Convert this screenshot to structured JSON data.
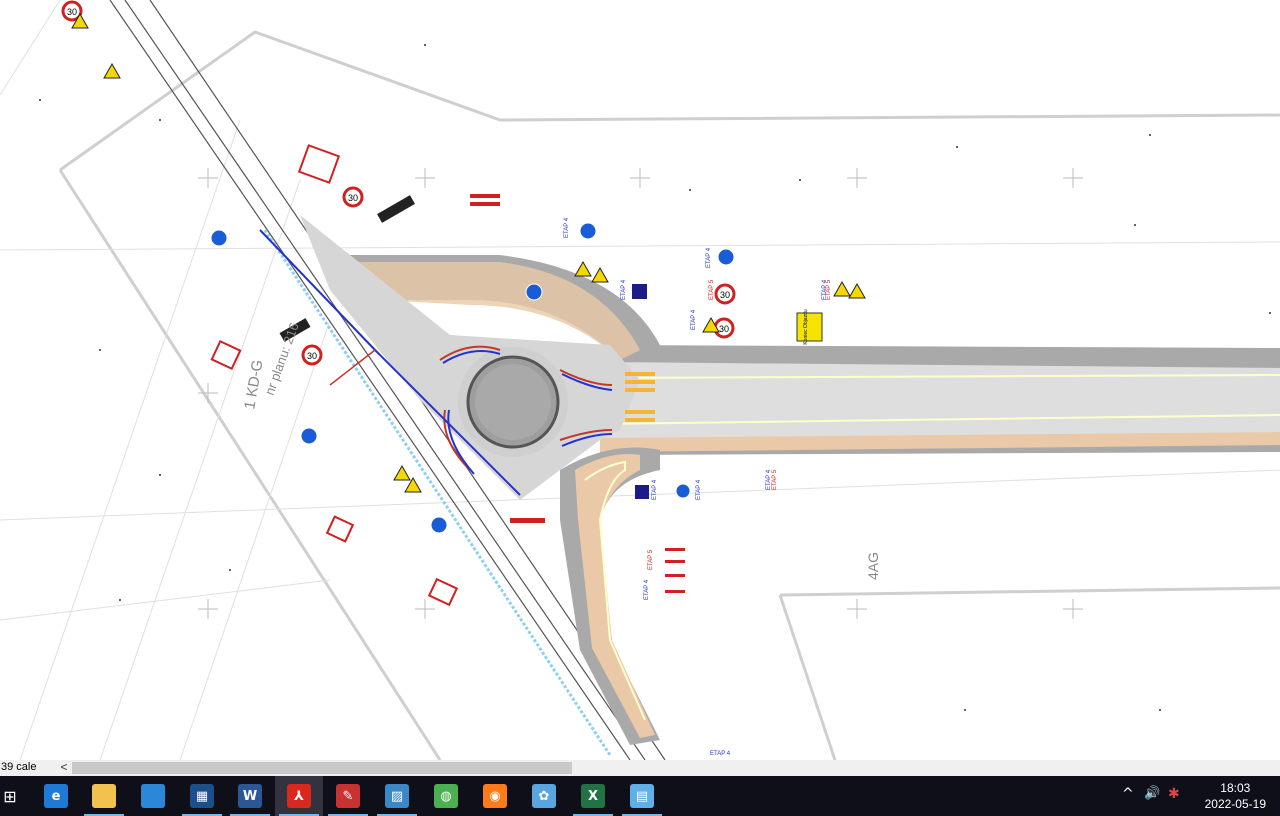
{
  "drawing": {
    "labels": {
      "kdg": "1 KD-G",
      "plan": "nr planu: 216",
      "area_4ag": "4AG",
      "end_sign": "Koniec Objazdu",
      "speed": "30"
    },
    "etap_labels": [
      "ETAP 4",
      "ETAP 5"
    ]
  },
  "statusbar": {
    "scale": "39 cale",
    "scroll_left": "<"
  },
  "taskbar": {
    "start_label": "⊞",
    "buttons": [
      {
        "name": "edge",
        "glyph": "e",
        "color": "#1e7ad6"
      },
      {
        "name": "file-explorer",
        "glyph": "",
        "color": "#f2c14e"
      },
      {
        "name": "store",
        "glyph": "",
        "color": "#2b88d8"
      },
      {
        "name": "app-viewer",
        "glyph": "▦",
        "color": "#1b4f8a"
      },
      {
        "name": "word",
        "glyph": "W",
        "color": "#2b5797"
      },
      {
        "name": "acrobat",
        "glyph": "⅄",
        "color": "#d9281e"
      },
      {
        "name": "pdf-tool",
        "glyph": "✎",
        "color": "#c83232"
      },
      {
        "name": "photos",
        "glyph": "▨",
        "color": "#3a88c8"
      },
      {
        "name": "chrome",
        "glyph": "◍",
        "color": "#4caf50"
      },
      {
        "name": "firefox",
        "glyph": "◉",
        "color": "#ff7a18"
      },
      {
        "name": "paint",
        "glyph": "✿",
        "color": "#5aa5e0"
      },
      {
        "name": "excel",
        "glyph": "X",
        "color": "#217346"
      },
      {
        "name": "notepad",
        "glyph": "▤",
        "color": "#5fb0e8"
      }
    ]
  },
  "tray": {
    "chevron": "^",
    "volume": "🔊",
    "dropbox": "✱",
    "time": "18:03",
    "date": "2022-05-19"
  }
}
